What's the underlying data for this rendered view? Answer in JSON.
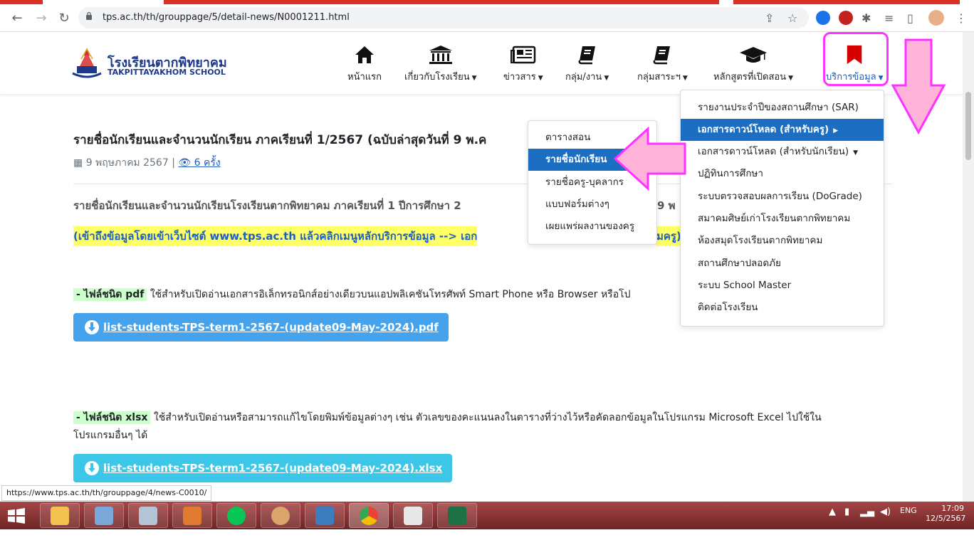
{
  "browser": {
    "url": "tps.ac.th/th/grouppage/5/detail-news/N0001211.html",
    "status_url": "https://www.tps.ac.th/th/grouppage/4/news-C0010/"
  },
  "site": {
    "name_th": "โรงเรียนตากพิทยาคม",
    "name_en": "TAKPITTAYAKHOM SCHOOL",
    "menu": [
      {
        "label": "หน้าแรก",
        "icon": "home-icon"
      },
      {
        "label": "เกี่ยวกับโรงเรียน",
        "icon": "institution-icon"
      },
      {
        "label": "ข่าวสาร",
        "icon": "newspaper-icon"
      },
      {
        "label": "กลุ่ม/งาน",
        "icon": "book-icon"
      },
      {
        "label": "กลุ่มสาระฯ",
        "icon": "book-icon"
      },
      {
        "label": "หลักสูตรที่เปิดสอน",
        "icon": "graduation-cap-icon"
      },
      {
        "label": "บริการข้อมูล",
        "icon": "bookmark-icon"
      }
    ]
  },
  "article": {
    "title": "รายชื่อนักเรียนและจำนวนนักเรียน ภาคเรียนที่ 1/2567 (ฉบับล่าสุดวันที่ 9 พ.ค",
    "date": "9 พฤษภาคม 2567",
    "views": "6 ครั้ง",
    "para1": "รายชื่อนักเรียนและจำนวนนักเรียนโรงเรียนตากพิทยาคม ภาคเรียนที่ 1  ปีการศึกษา 2",
    "para1_tail": "9 พ",
    "para2": "(เข้าถึงข้อมูลโดยเข้าเว็บไซต์ www.tps.ac.th แล้วคลิกเมนูหลักบริการข้อมูล --> เอก",
    "para2_tail": "มครู)",
    "pdf_tag": "- ไฟล์ชนิด pdf",
    "pdf_desc": "ใช้สำหรับเปิดอ่านเอกสารอิเล็กทรอนิกส์อย่างเดียวบนแอปพลิเคชันโทรศัพท์ Smart Phone หรือ Browser หรือโป",
    "pdf_file": "list-students-TPS-term1-2567-(update09-May-2024).pdf",
    "xlsx_tag": "- ไฟล์ชนิด xlsx",
    "xlsx_desc": "ใช้สำหรับเปิดอ่านหรือสามารถแก้ไขโดยพิมพ์ข้อมูลต่างๆ เช่น ตัวเลขของคะแนนลงในตารางที่ว่างไว้หรือคัดลอกข้อมูลในโปรแกรม Microsoft Excel  ไปใช้ใน",
    "xlsx_desc2": "โปรแกรมอื่นๆ ได้",
    "xlsx_file": "list-students-TPS-term1-2567-(update09-May-2024).xlsx"
  },
  "dropdown_main": [
    "รายงานประจำปีของสถานศึกษา (SAR)",
    "เอกสารดาวน์โหลด (สำหรับครู)",
    "เอกสารดาวน์โหลด (สำหรับนักเรียน)",
    "ปฏิทินการศึกษา",
    "ระบบตรวจสอบผลการเรียน (DoGrade)",
    "สมาคมศิษย์เก่าโรงเรียนตากพิทยาคม",
    "ห้องสมุดโรงเรียนตากพิทยาคม",
    "สถานศึกษาปลอดภัย",
    "ระบบ School Master",
    "ติดต่อโรงเรียน"
  ],
  "dropdown_sub": [
    "ตารางสอน",
    "รายชื่อนักเรียน",
    "รายชื่อครู-บุคลากร",
    "แบบฟอร์มต่างๆ",
    "เผยแพร่ผลงานของครู"
  ],
  "taskbar": {
    "lang": "ENG",
    "time": "17:09",
    "date": "12/5/2567"
  },
  "colors": {
    "accent": "#1b6ec2",
    "highlight_pink": "#ff33ff",
    "arrow_fill": "#ffb3d9"
  }
}
